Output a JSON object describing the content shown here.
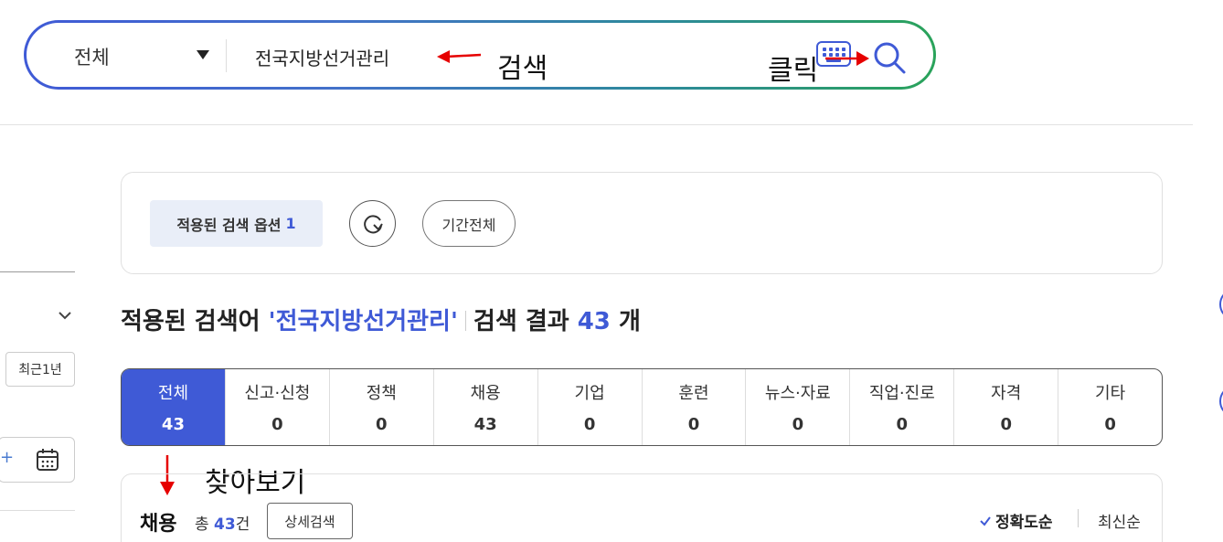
{
  "search": {
    "scope_label": "전체",
    "query": "전국지방선거관리"
  },
  "annotations": {
    "search_note": "검색",
    "click_note": "클릭",
    "browse_note": "찾아보기"
  },
  "sidebar": {
    "period_button": "최근1년",
    "date_plus": "+"
  },
  "options": {
    "applied_label": "적용된 검색 옵션",
    "applied_count": "1",
    "period_label": "기간전체"
  },
  "headline": {
    "prefix": "적용된 검색어",
    "keyword": "'전국지방선거관리'",
    "result_label": "검색 결과",
    "count": "43",
    "unit": "개"
  },
  "tabs": [
    {
      "label": "전체",
      "count": "43"
    },
    {
      "label": "신고·신청",
      "count": "0"
    },
    {
      "label": "정책",
      "count": "0"
    },
    {
      "label": "채용",
      "count": "43"
    },
    {
      "label": "기업",
      "count": "0"
    },
    {
      "label": "훈련",
      "count": "0"
    },
    {
      "label": "뉴스·자료",
      "count": "0"
    },
    {
      "label": "직업·진로",
      "count": "0"
    },
    {
      "label": "자격",
      "count": "0"
    },
    {
      "label": "기타",
      "count": "0"
    }
  ],
  "results": {
    "title": "채용",
    "total_prefix": "총",
    "total_count": "43",
    "total_suffix": "건",
    "detail_button": "상세검색",
    "sort_accuracy": "정확도순",
    "sort_latest": "최신순"
  },
  "colors": {
    "accent": "#3f5ad6",
    "annotation_arrow": "#e60000"
  }
}
